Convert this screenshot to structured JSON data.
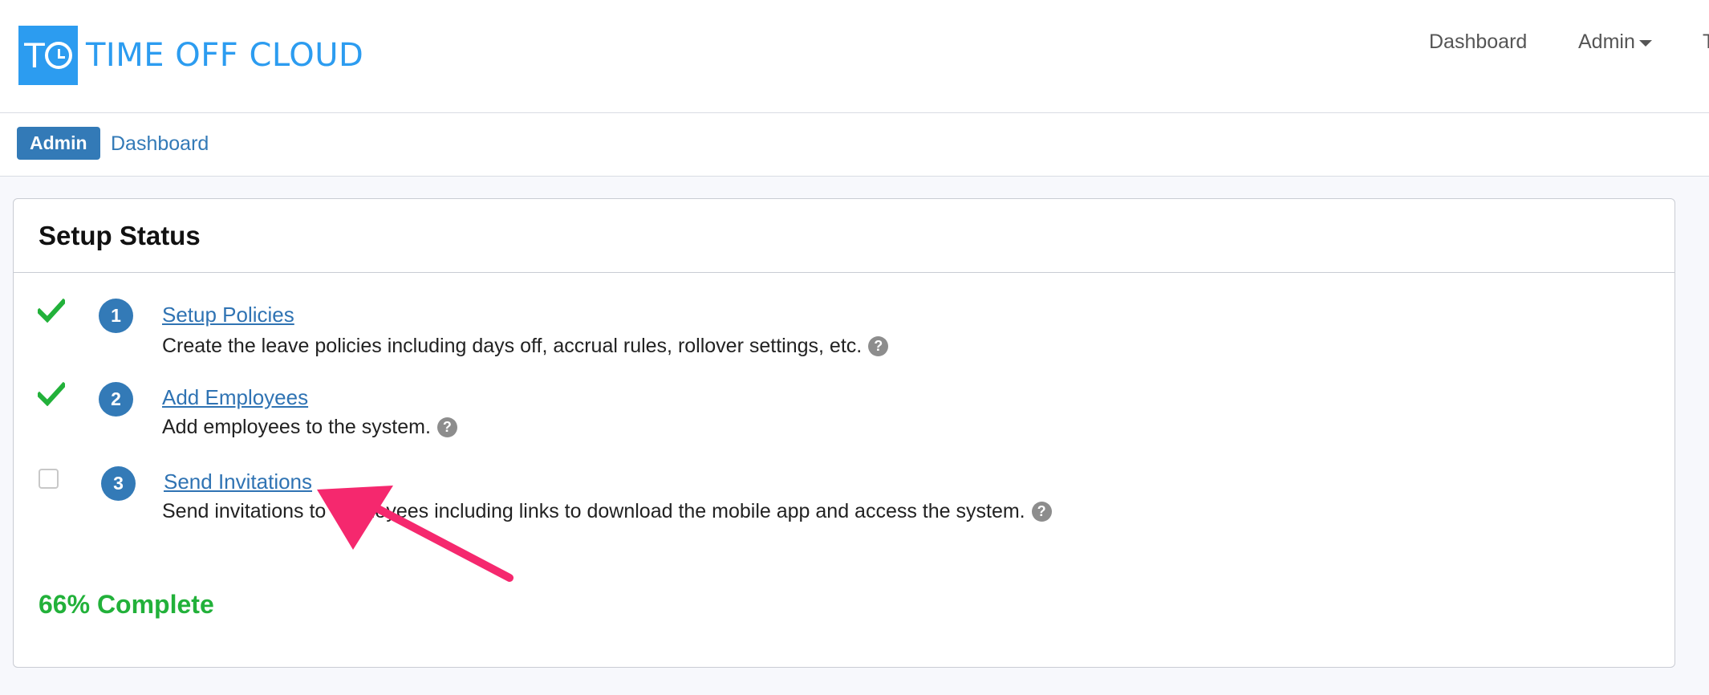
{
  "brand": {
    "logo_letter": "T",
    "name": "TIME OFF CLOUD",
    "color": "#2c9cf0"
  },
  "topnav": {
    "dashboard": "Dashboard",
    "admin": "Admin",
    "cut_item": "T"
  },
  "breadcrumb": {
    "badge": "Admin",
    "link": "Dashboard"
  },
  "panel": {
    "title": "Setup Status",
    "steps": [
      {
        "number": "1",
        "title": "Setup Policies",
        "description": "Create the leave policies including days off, accrual rules, rollover settings, etc.",
        "done": true
      },
      {
        "number": "2",
        "title": "Add Employees",
        "description": "Add employees to the system.",
        "done": true
      },
      {
        "number": "3",
        "title": "Send Invitations",
        "description": "Send invitations to employees including links to download the mobile app and access the system.",
        "done": false
      }
    ],
    "progress_text": "66% Complete",
    "progress_percent": 66
  },
  "colors": {
    "accent": "#337ab7",
    "success": "#22b13a",
    "annotation": "#f5286e"
  },
  "icons": {
    "done": "check-icon",
    "pending": "checkbox",
    "help": "question-circle-icon",
    "caret": "caret-down-icon"
  }
}
